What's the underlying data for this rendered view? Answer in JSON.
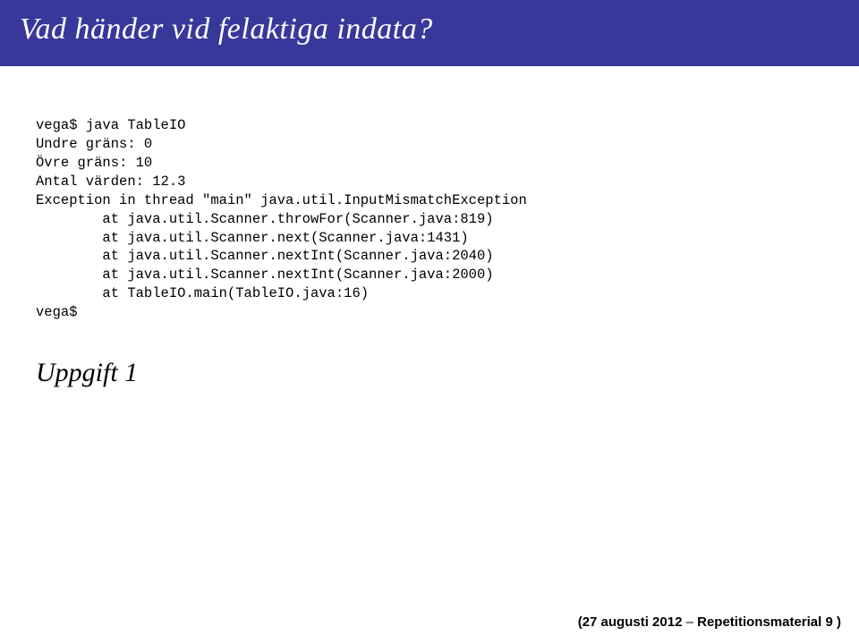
{
  "title": "Vad händer vid felaktiga indata?",
  "code": {
    "l1": "vega$ java TableIO",
    "l2": "Undre gräns: 0",
    "l3": "Övre gräns: 10",
    "l4": "Antal värden: 12.3",
    "l5": "Exception in thread \"main\" java.util.InputMismatchException",
    "l6": "        at java.util.Scanner.throwFor(Scanner.java:819)",
    "l7": "        at java.util.Scanner.next(Scanner.java:1431)",
    "l8": "        at java.util.Scanner.nextInt(Scanner.java:2040)",
    "l9": "        at java.util.Scanner.nextInt(Scanner.java:2000)",
    "l10": "        at TableIO.main(TableIO.java:16)",
    "l11": "vega$"
  },
  "uppgift": "Uppgift 1",
  "footer": {
    "date": "(27 augusti 2012",
    "dash": " – ",
    "label": "Repetitionsmaterial 9 )"
  }
}
